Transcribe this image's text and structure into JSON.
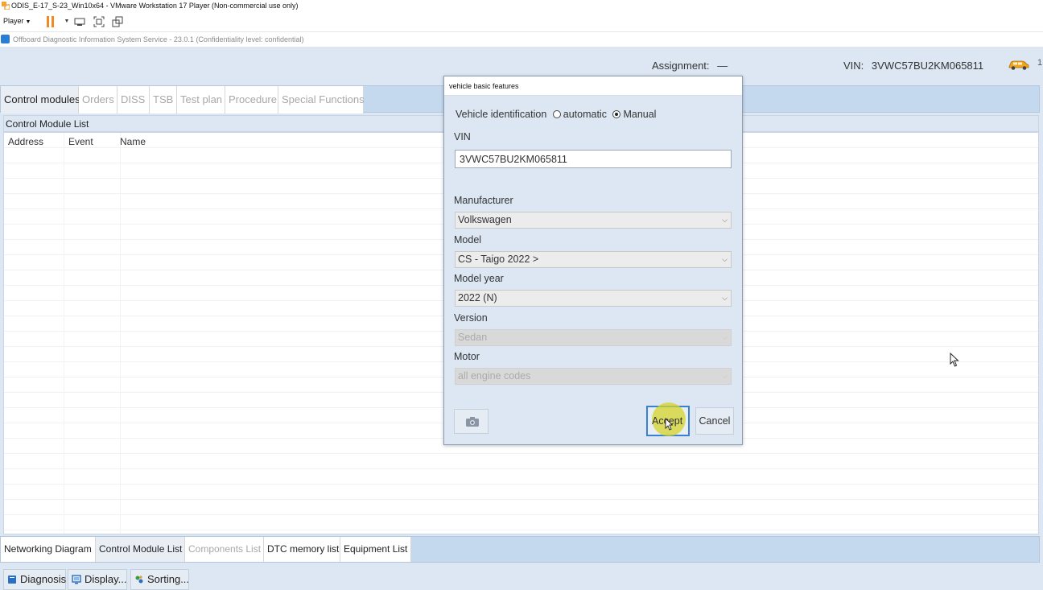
{
  "vm": {
    "window_title": "ODIS_E-17_S-23_Win10x64 - VMware Workstation 17 Player (Non-commercial use only)",
    "player_menu": "Player"
  },
  "odis": {
    "title": "Offboard Diagnostic Information System Service - 23.0.1 (Confidentiality level: confidential)"
  },
  "header": {
    "assignment_label": "Assignment:",
    "assignment_value": "—",
    "vin_label": "VIN:",
    "vin_value": "3VWC57BU2KM065811",
    "page_indicator": "1"
  },
  "main_tabs": [
    {
      "label": "Control modules",
      "active": true
    },
    {
      "label": "Orders",
      "active": false
    },
    {
      "label": "DISS",
      "active": false
    },
    {
      "label": "TSB",
      "active": false
    },
    {
      "label": "Test plan",
      "active": false
    },
    {
      "label": "Procedure",
      "active": false
    },
    {
      "label": "Special Functions",
      "active": false
    }
  ],
  "control_module_list": {
    "title": "Control Module List",
    "columns": [
      "Address",
      "Event",
      "Name"
    ]
  },
  "bottom_tabs": [
    {
      "label": "Networking Diagram",
      "active": true
    },
    {
      "label": "Control Module List",
      "active": true
    },
    {
      "label": "Components List",
      "active": false
    },
    {
      "label": "DTC memory list",
      "active": true
    },
    {
      "label": "Equipment List",
      "active": true
    }
  ],
  "bottom_buttons": [
    {
      "label": "Diagnosis",
      "icon": "book-icon"
    },
    {
      "label": "Display...",
      "icon": "display-icon"
    },
    {
      "label": "Sorting...",
      "icon": "sort-icon"
    }
  ],
  "dialog": {
    "title": "vehicle basic features",
    "identification_label": "Vehicle identification",
    "option_automatic": "automatic",
    "option_manual": "Manual",
    "selected_option": "Manual",
    "vin_label": "VIN",
    "vin_value": "3VWC57BU2KM065811",
    "manufacturer_label": "Manufacturer",
    "manufacturer_value": "Volkswagen",
    "model_label": "Model",
    "model_value": "CS - Taigo 2022 >",
    "model_year_label": "Model year",
    "model_year_value": "2022 (N)",
    "version_label": "Version",
    "version_value": "Sedan",
    "motor_label": "Motor",
    "motor_value": "all engine codes",
    "accept_label": "Accept",
    "cancel_label": "Cancel"
  },
  "colors": {
    "background": "#dce7f3",
    "tab_bar": "#c5d9ee",
    "accent_border": "#3b7fd0",
    "pause_orange": "#f08a24",
    "highlight": "#d6d428"
  }
}
